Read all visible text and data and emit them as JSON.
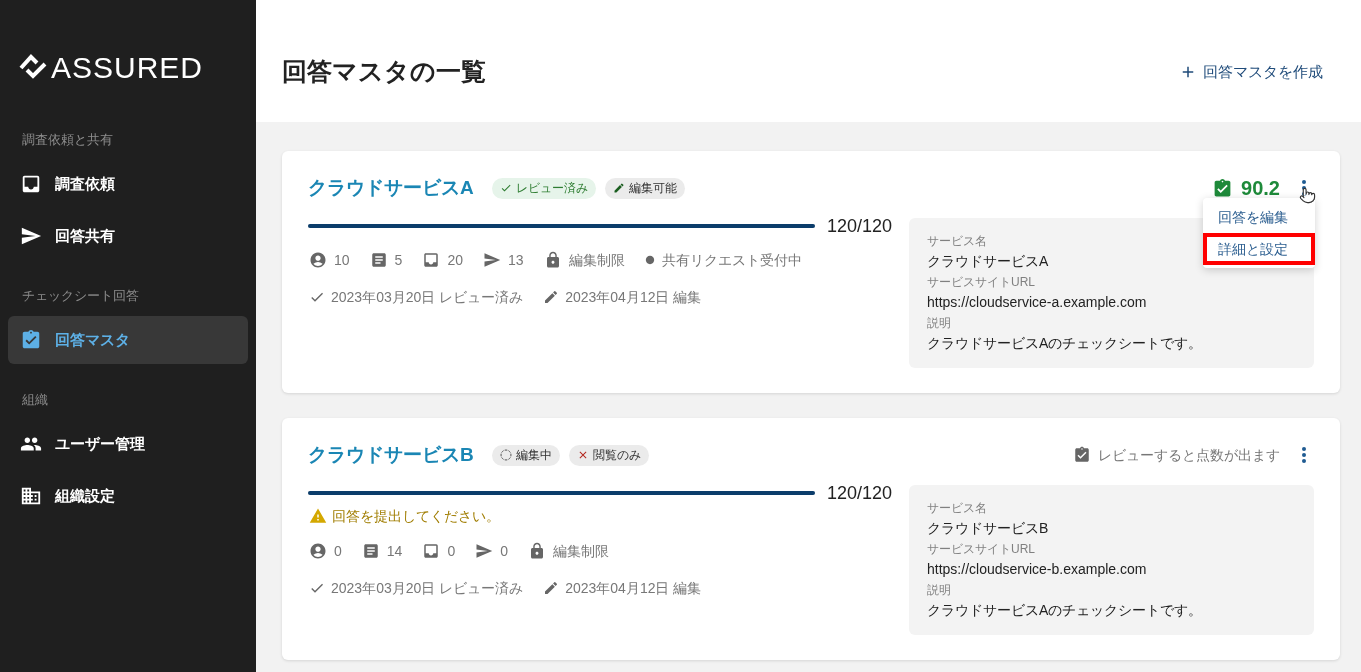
{
  "sidebar": {
    "logo": "ASSURED",
    "sections": [
      {
        "heading": "調査依頼と共有",
        "items": [
          {
            "label": "調査依頼",
            "selected": false
          },
          {
            "label": "回答共有",
            "selected": false
          }
        ]
      },
      {
        "heading": "チェックシート回答",
        "items": [
          {
            "label": "回答マスタ",
            "selected": true
          }
        ]
      },
      {
        "heading": "組織",
        "items": [
          {
            "label": "ユーザー管理",
            "selected": false
          },
          {
            "label": "組織設定",
            "selected": false
          }
        ]
      }
    ]
  },
  "header": {
    "title": "回答マスタの一覧",
    "create_button": "回答マスタを作成"
  },
  "cards": [
    {
      "title": "クラウドサービスA",
      "tags": [
        {
          "kind": "reviewed",
          "label": "レビュー済み"
        },
        {
          "kind": "editable",
          "label": "編集可能"
        }
      ],
      "score": {
        "kind": "score",
        "text": "90.2"
      },
      "menu_hovered": true,
      "menu": [
        {
          "label": "回答を編集",
          "highlighted": false
        },
        {
          "label": "詳細と設定",
          "highlighted": true
        }
      ],
      "progress": {
        "level": 1,
        "reading": "120/120"
      },
      "stats": [
        {
          "kind": "members",
          "text": "10"
        },
        {
          "kind": "sheets",
          "text": "5"
        },
        {
          "kind": "requests",
          "text": "20"
        },
        {
          "kind": "shares",
          "text": "13"
        },
        {
          "kind": "lock",
          "text": "編集制限"
        },
        {
          "kind": "status",
          "text": "共有リクエスト受付中"
        }
      ],
      "dates": [
        {
          "kind": "review",
          "text": "2023年03月20日 レビュー済み"
        },
        {
          "kind": "edit",
          "text": "2023年04月12日 編集"
        }
      ],
      "details": [
        {
          "label": "サービス名",
          "value": "クラウドサービスA"
        },
        {
          "label": "サービスサイトURL",
          "value": "https://cloudservice-a.example.com"
        },
        {
          "label": "説明",
          "value": "クラウドサービスAのチェックシートです。"
        }
      ]
    },
    {
      "title": "クラウドサービスB",
      "tags": [
        {
          "kind": "editing",
          "label": "編集中"
        },
        {
          "kind": "viewonly",
          "label": "閲覧のみ"
        }
      ],
      "score": {
        "kind": "pending",
        "text": "レビューすると点数が出ます"
      },
      "menu_hovered": false,
      "progress": {
        "level": 1,
        "reading": "120/120"
      },
      "warning": "回答を提出してください。",
      "stats": [
        {
          "kind": "members",
          "text": "0"
        },
        {
          "kind": "sheets",
          "text": "14"
        },
        {
          "kind": "requests",
          "text": "0"
        },
        {
          "kind": "shares",
          "text": "0"
        },
        {
          "kind": "lock",
          "text": "編集制限"
        }
      ],
      "dates": [
        {
          "kind": "review",
          "text": "2023年03月20日 レビュー済み"
        },
        {
          "kind": "edit",
          "text": "2023年04月12日 編集"
        }
      ],
      "details": [
        {
          "label": "サービス名",
          "value": "クラウドサービスB"
        },
        {
          "label": "サービスサイトURL",
          "value": "https://cloudservice-b.example.com"
        },
        {
          "label": "説明",
          "value": "クラウドサービスAのチェックシートです。"
        }
      ]
    }
  ]
}
